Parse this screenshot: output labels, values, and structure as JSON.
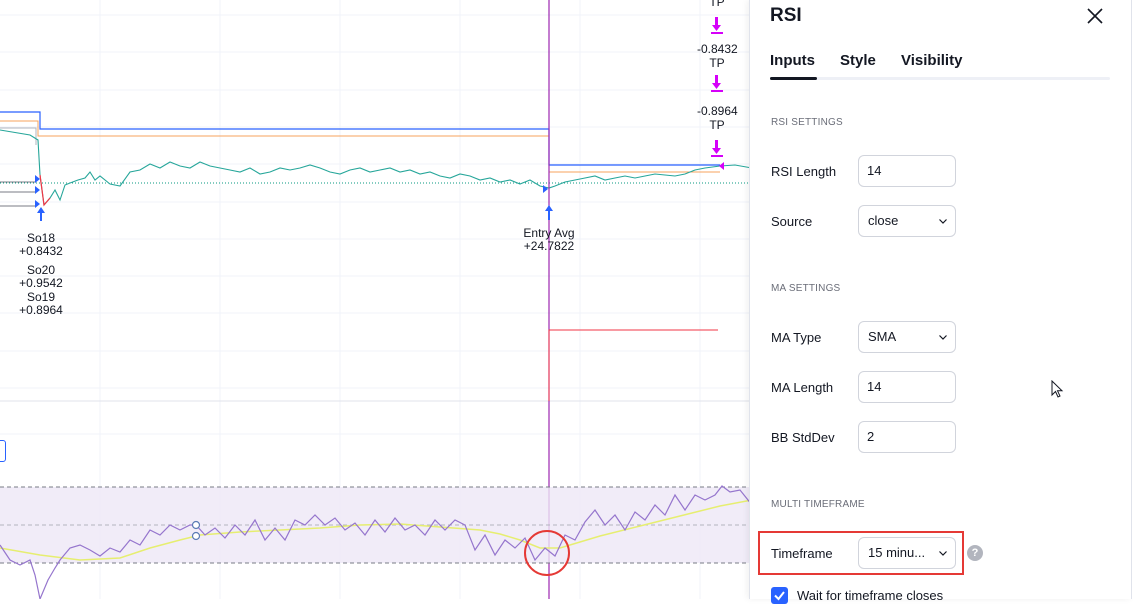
{
  "chart": {
    "trade_labels": [
      {
        "id": "so18",
        "lines": [
          "So18",
          "+0.8432"
        ]
      },
      {
        "id": "so20",
        "lines": [
          "So20",
          "+0.9542"
        ]
      },
      {
        "id": "so19",
        "lines": [
          "So19",
          "+0.8964"
        ]
      },
      {
        "id": "entry",
        "lines": [
          "Entry Avg",
          "+24.7822"
        ]
      }
    ],
    "tp_labels": [
      "TP",
      "-0.8432",
      "TP",
      "-0.8964",
      "TP"
    ],
    "colors": {
      "price_line": "#2962ff",
      "orange_line": "#f7a35c",
      "purple": "#9c27b0",
      "rsi_line": "#9575cd",
      "ma_line": "#e6ee70",
      "band": "#ede7f6",
      "red": "#f23645",
      "green": "#089981",
      "magenta_arrow": "#d500f9",
      "blue_arrow": "#2962ff"
    }
  },
  "dialog": {
    "title": "RSI",
    "tabs": [
      "Inputs",
      "Style",
      "Visibility"
    ],
    "active_tab": "Inputs",
    "sections": {
      "rsi_settings": "RSI SETTINGS",
      "ma_settings": "MA SETTINGS",
      "multi_timeframe": "MULTI TIMEFRAME"
    },
    "fields": {
      "rsi_length": {
        "label": "RSI Length",
        "value": "14"
      },
      "source": {
        "label": "Source",
        "value": "close"
      },
      "ma_type": {
        "label": "MA Type",
        "value": "SMA"
      },
      "ma_length": {
        "label": "MA Length",
        "value": "14"
      },
      "bb_stddev": {
        "label": "BB StdDev",
        "value": "2"
      },
      "timeframe": {
        "label": "Timeframe",
        "value": "15 minu..."
      }
    },
    "help_icon": "?",
    "wait_checkbox": {
      "label": "Wait for timeframe closes",
      "checked": true
    }
  }
}
